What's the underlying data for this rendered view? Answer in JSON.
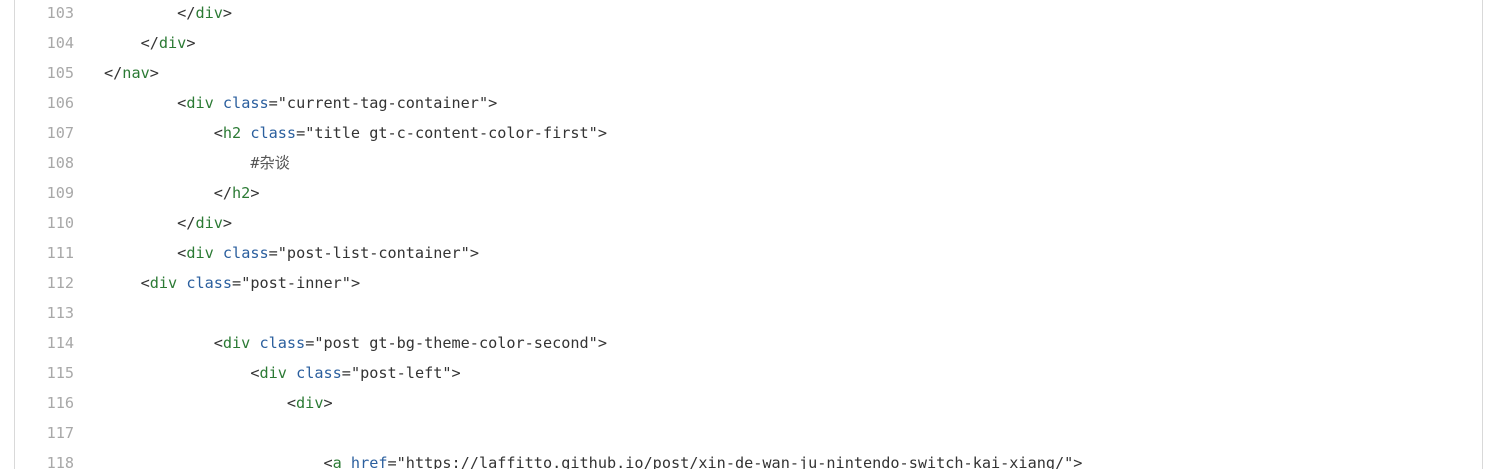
{
  "lines": [
    {
      "num": "103",
      "indent": "        ",
      "tokens": [
        {
          "t": "punct",
          "v": "</"
        },
        {
          "t": "tag",
          "v": "div"
        },
        {
          "t": "punct",
          "v": ">"
        }
      ]
    },
    {
      "num": "104",
      "indent": "    ",
      "tokens": [
        {
          "t": "punct",
          "v": "</"
        },
        {
          "t": "tag",
          "v": "div"
        },
        {
          "t": "punct",
          "v": ">"
        }
      ]
    },
    {
      "num": "105",
      "indent": "",
      "tokens": [
        {
          "t": "punct",
          "v": "</"
        },
        {
          "t": "tag",
          "v": "nav"
        },
        {
          "t": "punct",
          "v": ">"
        }
      ]
    },
    {
      "num": "106",
      "indent": "        ",
      "tokens": [
        {
          "t": "punct",
          "v": "<"
        },
        {
          "t": "tag",
          "v": "div"
        },
        {
          "t": "punct",
          "v": " "
        },
        {
          "t": "attr",
          "v": "class"
        },
        {
          "t": "punct",
          "v": "="
        },
        {
          "t": "str",
          "v": "\"current-tag-container\""
        },
        {
          "t": "punct",
          "v": ">"
        }
      ]
    },
    {
      "num": "107",
      "indent": "            ",
      "tokens": [
        {
          "t": "punct",
          "v": "<"
        },
        {
          "t": "tag",
          "v": "h2"
        },
        {
          "t": "punct",
          "v": " "
        },
        {
          "t": "attr",
          "v": "class"
        },
        {
          "t": "punct",
          "v": "="
        },
        {
          "t": "str",
          "v": "\"title gt-c-content-color-first\""
        },
        {
          "t": "punct",
          "v": ">"
        }
      ]
    },
    {
      "num": "108",
      "indent": "                ",
      "tokens": [
        {
          "t": "text",
          "v": "#杂谈"
        }
      ]
    },
    {
      "num": "109",
      "indent": "            ",
      "tokens": [
        {
          "t": "punct",
          "v": "</"
        },
        {
          "t": "tag",
          "v": "h2"
        },
        {
          "t": "punct",
          "v": ">"
        }
      ]
    },
    {
      "num": "110",
      "indent": "        ",
      "tokens": [
        {
          "t": "punct",
          "v": "</"
        },
        {
          "t": "tag",
          "v": "div"
        },
        {
          "t": "punct",
          "v": ">"
        }
      ]
    },
    {
      "num": "111",
      "indent": "        ",
      "tokens": [
        {
          "t": "punct",
          "v": "<"
        },
        {
          "t": "tag",
          "v": "div"
        },
        {
          "t": "punct",
          "v": " "
        },
        {
          "t": "attr",
          "v": "class"
        },
        {
          "t": "punct",
          "v": "="
        },
        {
          "t": "str",
          "v": "\"post-list-container\""
        },
        {
          "t": "punct",
          "v": ">"
        }
      ]
    },
    {
      "num": "112",
      "indent": "    ",
      "tokens": [
        {
          "t": "punct",
          "v": "<"
        },
        {
          "t": "tag",
          "v": "div"
        },
        {
          "t": "punct",
          "v": " "
        },
        {
          "t": "attr",
          "v": "class"
        },
        {
          "t": "punct",
          "v": "="
        },
        {
          "t": "str",
          "v": "\"post-inner\""
        },
        {
          "t": "punct",
          "v": ">"
        }
      ]
    },
    {
      "num": "113",
      "indent": "",
      "tokens": []
    },
    {
      "num": "114",
      "indent": "            ",
      "tokens": [
        {
          "t": "punct",
          "v": "<"
        },
        {
          "t": "tag",
          "v": "div"
        },
        {
          "t": "punct",
          "v": " "
        },
        {
          "t": "attr",
          "v": "class"
        },
        {
          "t": "punct",
          "v": "="
        },
        {
          "t": "str",
          "v": "\"post gt-bg-theme-color-second\""
        },
        {
          "t": "punct",
          "v": ">"
        }
      ]
    },
    {
      "num": "115",
      "indent": "                ",
      "tokens": [
        {
          "t": "punct",
          "v": "<"
        },
        {
          "t": "tag",
          "v": "div"
        },
        {
          "t": "punct",
          "v": " "
        },
        {
          "t": "attr",
          "v": "class"
        },
        {
          "t": "punct",
          "v": "="
        },
        {
          "t": "str",
          "v": "\"post-left\""
        },
        {
          "t": "punct",
          "v": ">"
        }
      ]
    },
    {
      "num": "116",
      "indent": "                    ",
      "tokens": [
        {
          "t": "punct",
          "v": "<"
        },
        {
          "t": "tag",
          "v": "div"
        },
        {
          "t": "punct",
          "v": ">"
        }
      ]
    },
    {
      "num": "117",
      "indent": "",
      "tokens": []
    },
    {
      "num": "118",
      "indent": "                        ",
      "tokens": [
        {
          "t": "punct",
          "v": "<"
        },
        {
          "t": "tag",
          "v": "a"
        },
        {
          "t": "punct",
          "v": " "
        },
        {
          "t": "attr",
          "v": "href"
        },
        {
          "t": "punct",
          "v": "="
        },
        {
          "t": "str",
          "v": "\"https://laffitto.github.io/post/xin-de-wan-ju-nintendo-switch-kai-xiang/\""
        },
        {
          "t": "punct",
          "v": ">"
        }
      ]
    }
  ],
  "colors": {
    "tag": "#2b7a34",
    "attr": "#2b5f9e",
    "line_number": "#a8a8a8"
  }
}
